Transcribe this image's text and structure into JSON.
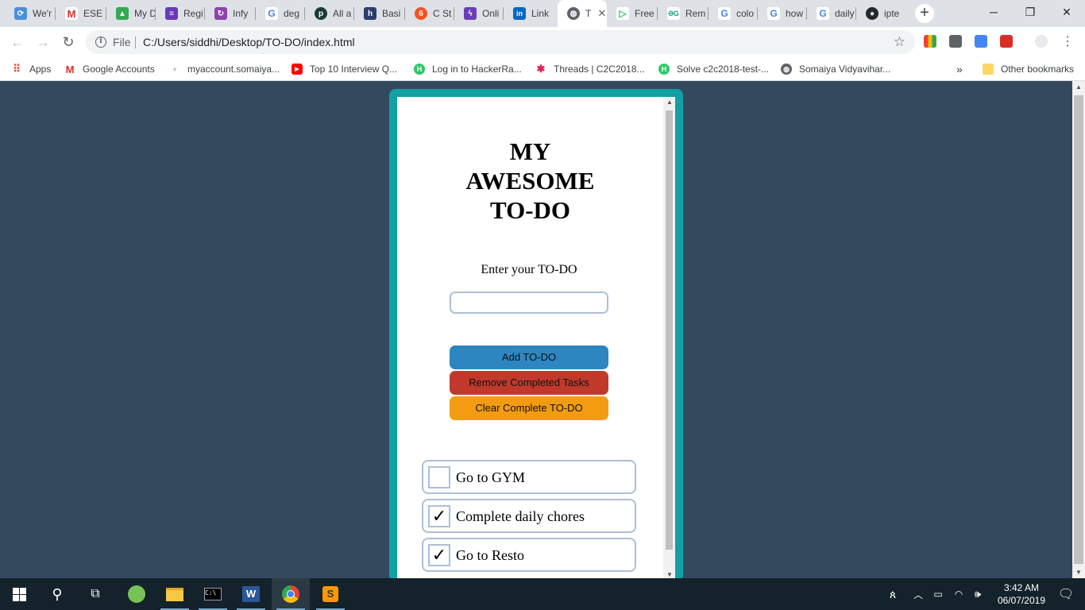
{
  "browser": {
    "tabs": [
      {
        "label": "We'r",
        "icon": "sync-icon",
        "color": "#4a90d9"
      },
      {
        "label": "ESE",
        "icon": "gmail-icon",
        "color": "#d93025"
      },
      {
        "label": "My D",
        "icon": "drive-icon",
        "color": "#34a853"
      },
      {
        "label": "Regi",
        "icon": "forms-icon",
        "color": "#673ab7"
      },
      {
        "label": "Infy",
        "icon": "infy-icon",
        "color": "#8e44ad"
      },
      {
        "label": "deg",
        "icon": "google-icon",
        "color": "#4285f4"
      },
      {
        "label": "All a",
        "icon": "pluralsight-icon",
        "color": "#1b3a3a"
      },
      {
        "label": "Basi",
        "icon": "hashnode-icon",
        "color": "#2c3e6b"
      },
      {
        "label": "C St",
        "icon": "codechef-icon",
        "color": "#f4511e"
      },
      {
        "label": "Onli",
        "icon": "bolt-icon",
        "color": "#6a3fb5"
      },
      {
        "label": "Link",
        "icon": "linkedin-icon",
        "color": "#0a66c2"
      },
      {
        "label": "T",
        "icon": "globe-icon",
        "color": "#5f6368"
      },
      {
        "label": "Free",
        "icon": "play-icon",
        "color": "#2ecc71"
      },
      {
        "label": "Rem",
        "icon": "gg-icon",
        "color": "#16a085"
      },
      {
        "label": "colo",
        "icon": "google-icon",
        "color": "#4285f4"
      },
      {
        "label": "how",
        "icon": "google-icon",
        "color": "#4285f4"
      },
      {
        "label": "daily",
        "icon": "google-icon",
        "color": "#4285f4"
      },
      {
        "label": "ipte",
        "icon": "github-icon",
        "color": "#24292e"
      }
    ],
    "address": {
      "scheme": "File",
      "url": "C:/Users/siddhi/Desktop/TO-DO/index.html"
    },
    "bookmarks": [
      {
        "label": "Apps",
        "icon": "apps-grid-icon",
        "color": "#ea4335"
      },
      {
        "label": "Google Accounts",
        "icon": "gmail-icon",
        "color": "#d93025"
      },
      {
        "label": "myaccount.somaiya...",
        "icon": "somaiya-icon",
        "color": "#c0392b"
      },
      {
        "label": "Top 10 Interview Q...",
        "icon": "youtube-icon",
        "color": "#ff0000"
      },
      {
        "label": "Log in to HackerRa...",
        "icon": "hackerrank-icon",
        "color": "#2ec866"
      },
      {
        "label": "Threads | C2C2018...",
        "icon": "slack-icon",
        "color": "#e01e5a"
      },
      {
        "label": "Solve c2c2018-test-...",
        "icon": "hackerrank-icon",
        "color": "#2ec866"
      },
      {
        "label": "Somaiya Vidyavihar...",
        "icon": "globe-icon",
        "color": "#5f6368"
      }
    ],
    "overflow": "»",
    "other_bookmarks": "Other bookmarks"
  },
  "app": {
    "title_lines": [
      "MY",
      "AWESOME",
      "TO-DO"
    ],
    "prompt": "Enter your TO-DO",
    "input_value": "",
    "buttons": {
      "add": "Add TO-DO",
      "remove": "Remove Completed Tasks",
      "clear": "Clear Complete TO-DO"
    },
    "todos": [
      {
        "text": "Go to GYM",
        "completed": false
      },
      {
        "text": "Complete daily chores",
        "completed": true
      },
      {
        "text": "Go to Resto",
        "completed": true
      }
    ],
    "check_mark": "✓"
  },
  "taskbar": {
    "time": "3:42 AM",
    "date": "06/07/2019"
  },
  "colors": {
    "page_bg": "#34495e",
    "frame": "#11a0a4",
    "add_button": "#2e86c1",
    "remove_button": "#c0392b",
    "clear_button": "#f39c12"
  }
}
